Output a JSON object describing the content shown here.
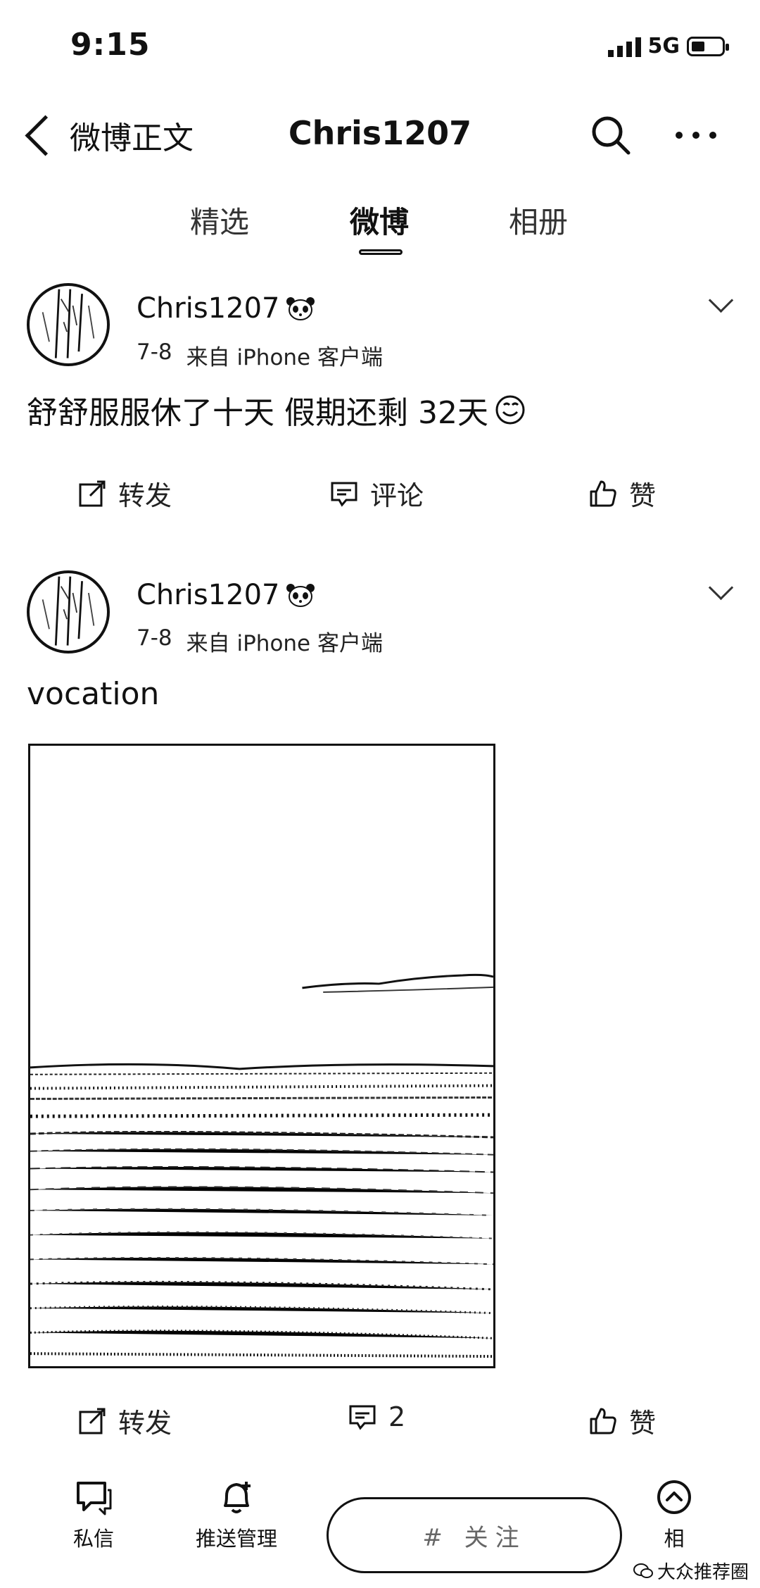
{
  "status_bar": {
    "time": "9:15",
    "network": "5G"
  },
  "header": {
    "back_label": "微博正文",
    "title": "Chris1207"
  },
  "tabs": [
    {
      "label": "精选",
      "active": false
    },
    {
      "label": "微博",
      "active": true
    },
    {
      "label": "相册",
      "active": false
    }
  ],
  "posts": [
    {
      "username": "Chris1207",
      "date": "7-8",
      "source": "来自 iPhone 客户端",
      "text": "舒舒服服休了十天 假期还剩 32天",
      "actions": {
        "repost": "转发",
        "comment": "评论",
        "like": "赞"
      }
    },
    {
      "username": "Chris1207",
      "date": "7-8",
      "source": "来自 iPhone 客户端",
      "text": "vocation",
      "actions": {
        "repost": "转发",
        "comment": "2",
        "like": "赞"
      }
    }
  ],
  "bottom_bar": {
    "messages": "私信",
    "push_settings": "推送管理",
    "compose": "# 关注",
    "recommend_prefix": "相",
    "watermark": "大众推荐圈"
  },
  "colors": {
    "text": "#111111",
    "background": "#ffffff"
  }
}
